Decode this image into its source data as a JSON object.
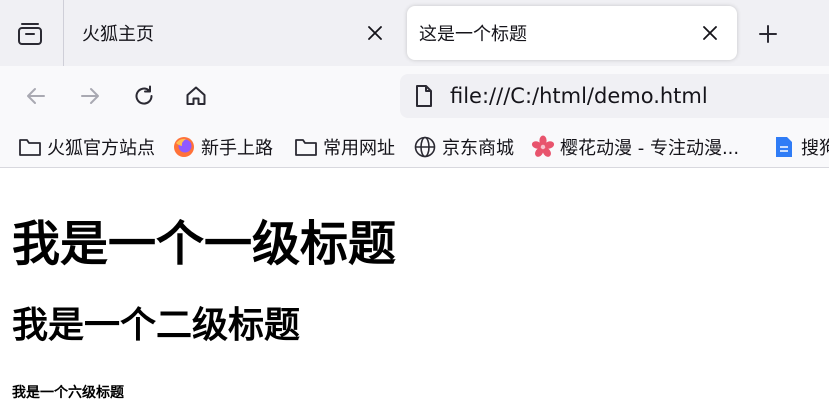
{
  "tabs": [
    {
      "title": "火狐主页",
      "active": false
    },
    {
      "title": "这是一个标题",
      "active": true
    }
  ],
  "nav": {
    "url": "file:///C:/html/demo.html"
  },
  "bookmarks": [
    {
      "label": "火狐官方站点",
      "icon": "folder-icon"
    },
    {
      "label": "新手上路",
      "icon": "firefox-icon"
    },
    {
      "label": "常用网址",
      "icon": "folder-icon"
    },
    {
      "label": "京东商城",
      "icon": "globe-icon"
    },
    {
      "label": "樱花动漫 - 专注动漫...",
      "icon": "sakura-icon"
    },
    {
      "label": "搜狗",
      "icon": "blue-doc-icon"
    }
  ],
  "page": {
    "h1": "我是一个一级标题",
    "h2": "我是一个二级标题",
    "h6": "我是一个六级标题"
  },
  "colors": {
    "tabstrip_bg": "#f0f0f4",
    "toolbar_bg": "#f9f9fb",
    "urlbar_bg": "#f0f0f4",
    "sakura": "#e8546d",
    "doc_blue": "#2f7cf6"
  }
}
